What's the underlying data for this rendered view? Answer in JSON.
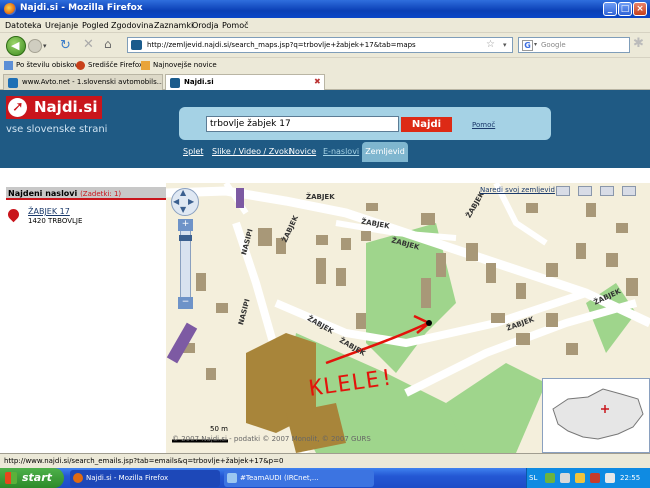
{
  "window": {
    "title": "Najdi.si - Mozilla Firefox"
  },
  "menu": [
    "Datoteka",
    "Urejanje",
    "Pogled",
    "Zgodovina",
    "Zaznamki",
    "Orodja",
    "Pomoč"
  ],
  "address": {
    "url": "http://zemljevid.najdi.si/search_maps.jsp?q=trbovlje+žabjek+17&tab=maps"
  },
  "search": {
    "placeholder": "Google"
  },
  "bookmarks": [
    "Po številu obiskov",
    "Središče Firefox",
    "Najnovejše novice"
  ],
  "tabs": [
    {
      "label": "www.Avto.net - 1.slovenski avtomobils..."
    },
    {
      "label": "Najdi.si"
    }
  ],
  "site": {
    "logo": "Najdi.si",
    "tagline": "vse slovenske strani",
    "query": "trbovlje žabjek 17",
    "search_button": "Najdi",
    "help": "Pomoč",
    "nav": [
      "Splet",
      "Slike / Video / Zvoki",
      "Novice",
      "E-naslovi",
      "Zemljevid"
    ],
    "active_nav": "Zemljevid"
  },
  "results": {
    "header": "Najdeni naslovi",
    "count_label": "(Zadetki: 1)",
    "items": [
      {
        "name": "ŽABJEK 17",
        "city": "1420 TRBOVLJE"
      }
    ]
  },
  "map": {
    "make_map": "Naredi svoj zemljevid",
    "streets": [
      "ŽABJEK",
      "ŽABJEK",
      "ŽABJEK",
      "ŽABJEK",
      "ŽABJEK",
      "ŽABJEK",
      "ŽABJEK",
      "NASIPI",
      "NASIPI",
      "ŽABJEK",
      "ŽABJEK"
    ],
    "annotation": "KLELE!",
    "scale": "50 m",
    "copyright": "© 2007 Najdi.si - podatki © 2007 Monolit, © 2007 GURS"
  },
  "status": {
    "text": "http://www.najdi.si/search_emails.jsp?tab=emails&q=trbovlje+žabjek+17&p=0"
  },
  "taskbar": {
    "start": "start",
    "tasks": [
      "Najdi.si - Mozilla Firefox",
      "#TeamAUDI (IRCnet,..."
    ],
    "lang": "SL",
    "clock": "22:55"
  },
  "colors": {
    "brand_red": "#c9151c",
    "header_blue": "#1f5a84",
    "panel_blue": "#a5d2e5"
  }
}
